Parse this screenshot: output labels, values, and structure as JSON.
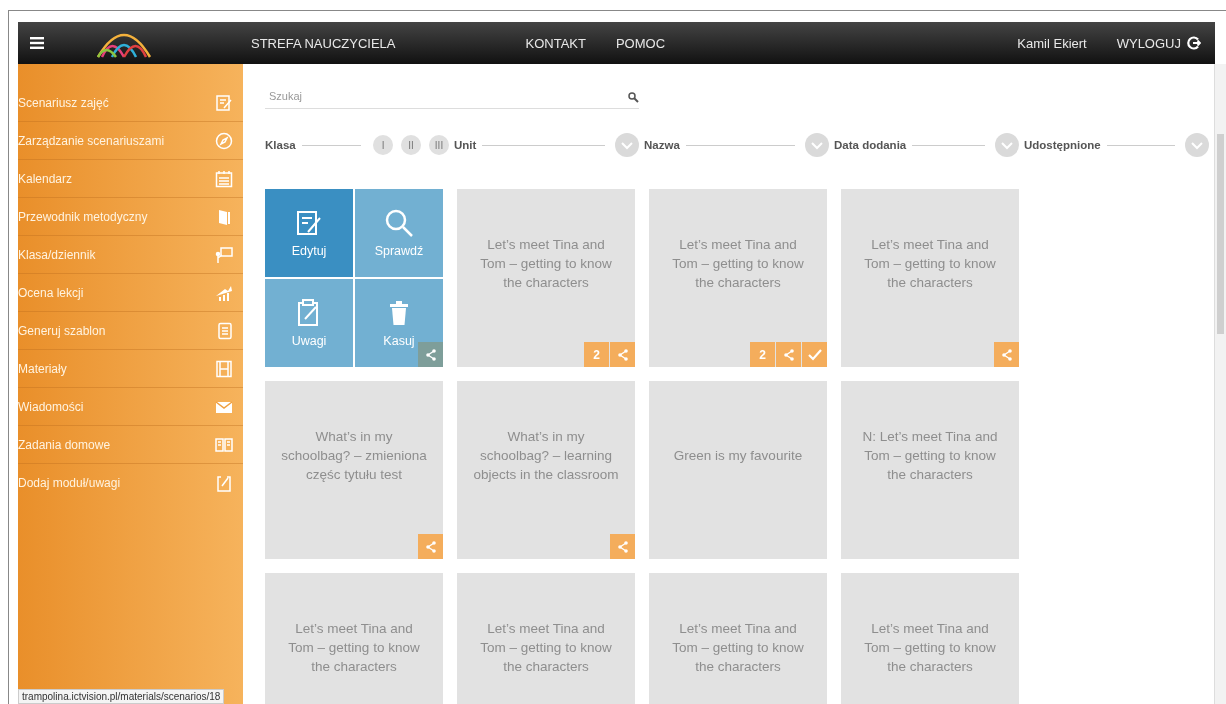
{
  "header": {
    "nav": [
      "STREFA NAUCZYCIELA",
      "KONTAKT",
      "POMOC"
    ],
    "user": "Kamil Ekiert",
    "logout": "WYLOGUJ"
  },
  "sidebar": {
    "items": [
      {
        "label": "Scenariusz zajęć",
        "kind": "edit"
      },
      {
        "label": "Zarządzanie scenariuszami",
        "kind": "compass"
      },
      {
        "label": "Kalendarz",
        "kind": "calendar"
      },
      {
        "label": "Przewodnik metodyczny",
        "kind": "book"
      },
      {
        "label": "Klasa/dziennik",
        "kind": "board"
      },
      {
        "label": "Ocena lekcji",
        "kind": "chart"
      },
      {
        "label": "Generuj szablon",
        "kind": "doc"
      },
      {
        "label": "Materiały",
        "kind": "film"
      },
      {
        "label": "Wiadomości",
        "kind": "mail"
      },
      {
        "label": "Zadania domowe",
        "kind": "openbook"
      },
      {
        "label": "Dodaj moduł/uwagi",
        "kind": "note"
      }
    ]
  },
  "search": {
    "placeholder": "Szukaj"
  },
  "filters": [
    {
      "label": "Klasa",
      "kind": "levels",
      "options": [
        {
          "label": "I",
          "selected": false
        },
        {
          "label": "II",
          "selected": false
        },
        {
          "label": "III",
          "selected": false
        }
      ]
    },
    {
      "label": "Unit",
      "kind": "dropdown"
    },
    {
      "label": "Nazwa",
      "kind": "dropdown"
    },
    {
      "label": "Data dodania",
      "kind": "dropdown"
    },
    {
      "label": "Udostępnione",
      "kind": "dropdown"
    }
  ],
  "tiles": [
    {
      "shared": true,
      "checked": false,
      "actions": [
        {
          "label": "Edytuj",
          "kind": "edit",
          "selected": true
        },
        {
          "label": "Sprawdź",
          "kind": "search",
          "selected": false
        },
        {
          "label": "Uwagi",
          "kind": "note",
          "selected": false
        },
        {
          "label": "Kasuj",
          "kind": "delete",
          "selected": false
        }
      ]
    },
    {
      "title": "Let’s meet Tina and Tom – getting to know the characters",
      "count": "2",
      "shared": true,
      "checked": false
    },
    {
      "title": "Let’s meet Tina and Tom – getting to know the characters",
      "count": "2",
      "shared": true,
      "checked": true
    },
    {
      "title": "Let’s meet Tina and Tom – getting to know the characters",
      "shared": true,
      "checked": false
    },
    {
      "title": "What’s in my schoolbag? – zmieniona częśc tytułu test",
      "shared": true,
      "checked": false
    },
    {
      "title": "What’s in my schoolbag? – learning objects in the classroom",
      "shared": true,
      "checked": false
    },
    {
      "title": "Green is my favourite",
      "shared": false,
      "checked": false
    },
    {
      "title": "N: Let’s meet Tina and Tom – getting to know the characters",
      "shared": false,
      "checked": false
    },
    {
      "title": "Let’s meet Tina and Tom – getting to know the characters",
      "shared": false,
      "checked": false
    },
    {
      "title": "Let’s meet Tina and Tom – getting to know the characters",
      "shared": false,
      "checked": false
    },
    {
      "title": "Let’s meet Tina and Tom – getting to know the characters",
      "shared": false,
      "checked": false
    },
    {
      "title": "Let’s meet Tina and Tom – getting to know the characters",
      "shared": false,
      "checked": false
    }
  ],
  "status_bar": {
    "url": "trampolina.ictvision.pl/materials/scenarios/18"
  }
}
